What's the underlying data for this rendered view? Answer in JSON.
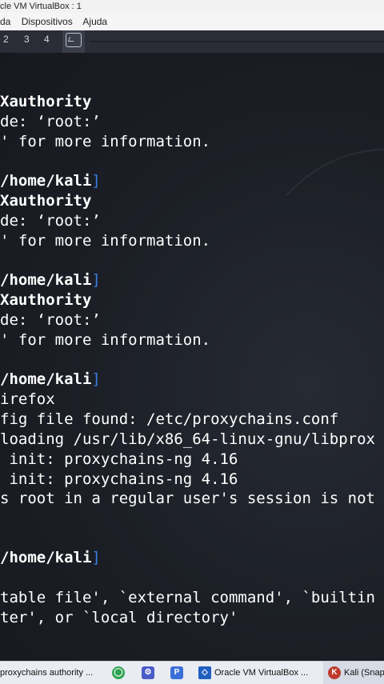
{
  "window": {
    "title": "cle VM VirtualBox : 1"
  },
  "menu": {
    "items": [
      "da",
      "Dispositivos",
      "Ajuda"
    ]
  },
  "panel": {
    "workspaces": [
      "2",
      "3",
      "4"
    ]
  },
  "terminal": {
    "lines": [
      {
        "text": "Xauthority",
        "kind": "bold"
      },
      {
        "text": "de: ‘root:’",
        "kind": "normal"
      },
      {
        "text": "' for more information.",
        "kind": "normal"
      },
      {
        "text": "/home/kali",
        "kind": "path"
      },
      {
        "text": "Xauthority",
        "kind": "bold"
      },
      {
        "text": "de: ‘root:’",
        "kind": "normal"
      },
      {
        "text": "' for more information.",
        "kind": "normal"
      },
      {
        "text": "/home/kali",
        "kind": "path"
      },
      {
        "text": "Xauthority",
        "kind": "bold"
      },
      {
        "text": "de: ‘root:’",
        "kind": "normal"
      },
      {
        "text": "' for more information.",
        "kind": "normal"
      },
      {
        "text": "/home/kali",
        "kind": "path"
      },
      {
        "text": "irefox",
        "kind": "normal"
      },
      {
        "text": "fig file found: /etc/proxychains.conf",
        "kind": "normal"
      },
      {
        "text": "loading /usr/lib/x86_64-linux-gnu/libprox",
        "kind": "normal"
      },
      {
        "text": " init: proxychains-ng 4.16",
        "kind": "normal"
      },
      {
        "text": " init: proxychains-ng 4.16",
        "kind": "normal"
      },
      {
        "text": "s root in a regular user's session is not",
        "kind": "normal"
      },
      {
        "text": "/home/kali",
        "kind": "path"
      },
      {
        "text": "table file', `external command', `builtin",
        "kind": "normal"
      },
      {
        "text": "ter', or `local directory'",
        "kind": "normal"
      }
    ]
  },
  "taskbar": {
    "items": [
      {
        "label": "proxychains authority ...",
        "icon": "none"
      },
      {
        "label": "",
        "icon": "green-circle-icon"
      },
      {
        "label": "",
        "icon": "app-icon"
      },
      {
        "label": "",
        "icon": "p-icon"
      },
      {
        "label": "Oracle VM VirtualBox ...",
        "icon": "virtualbox-icon"
      },
      {
        "label": "Kali (Snap",
        "icon": "kali-icon"
      }
    ]
  }
}
